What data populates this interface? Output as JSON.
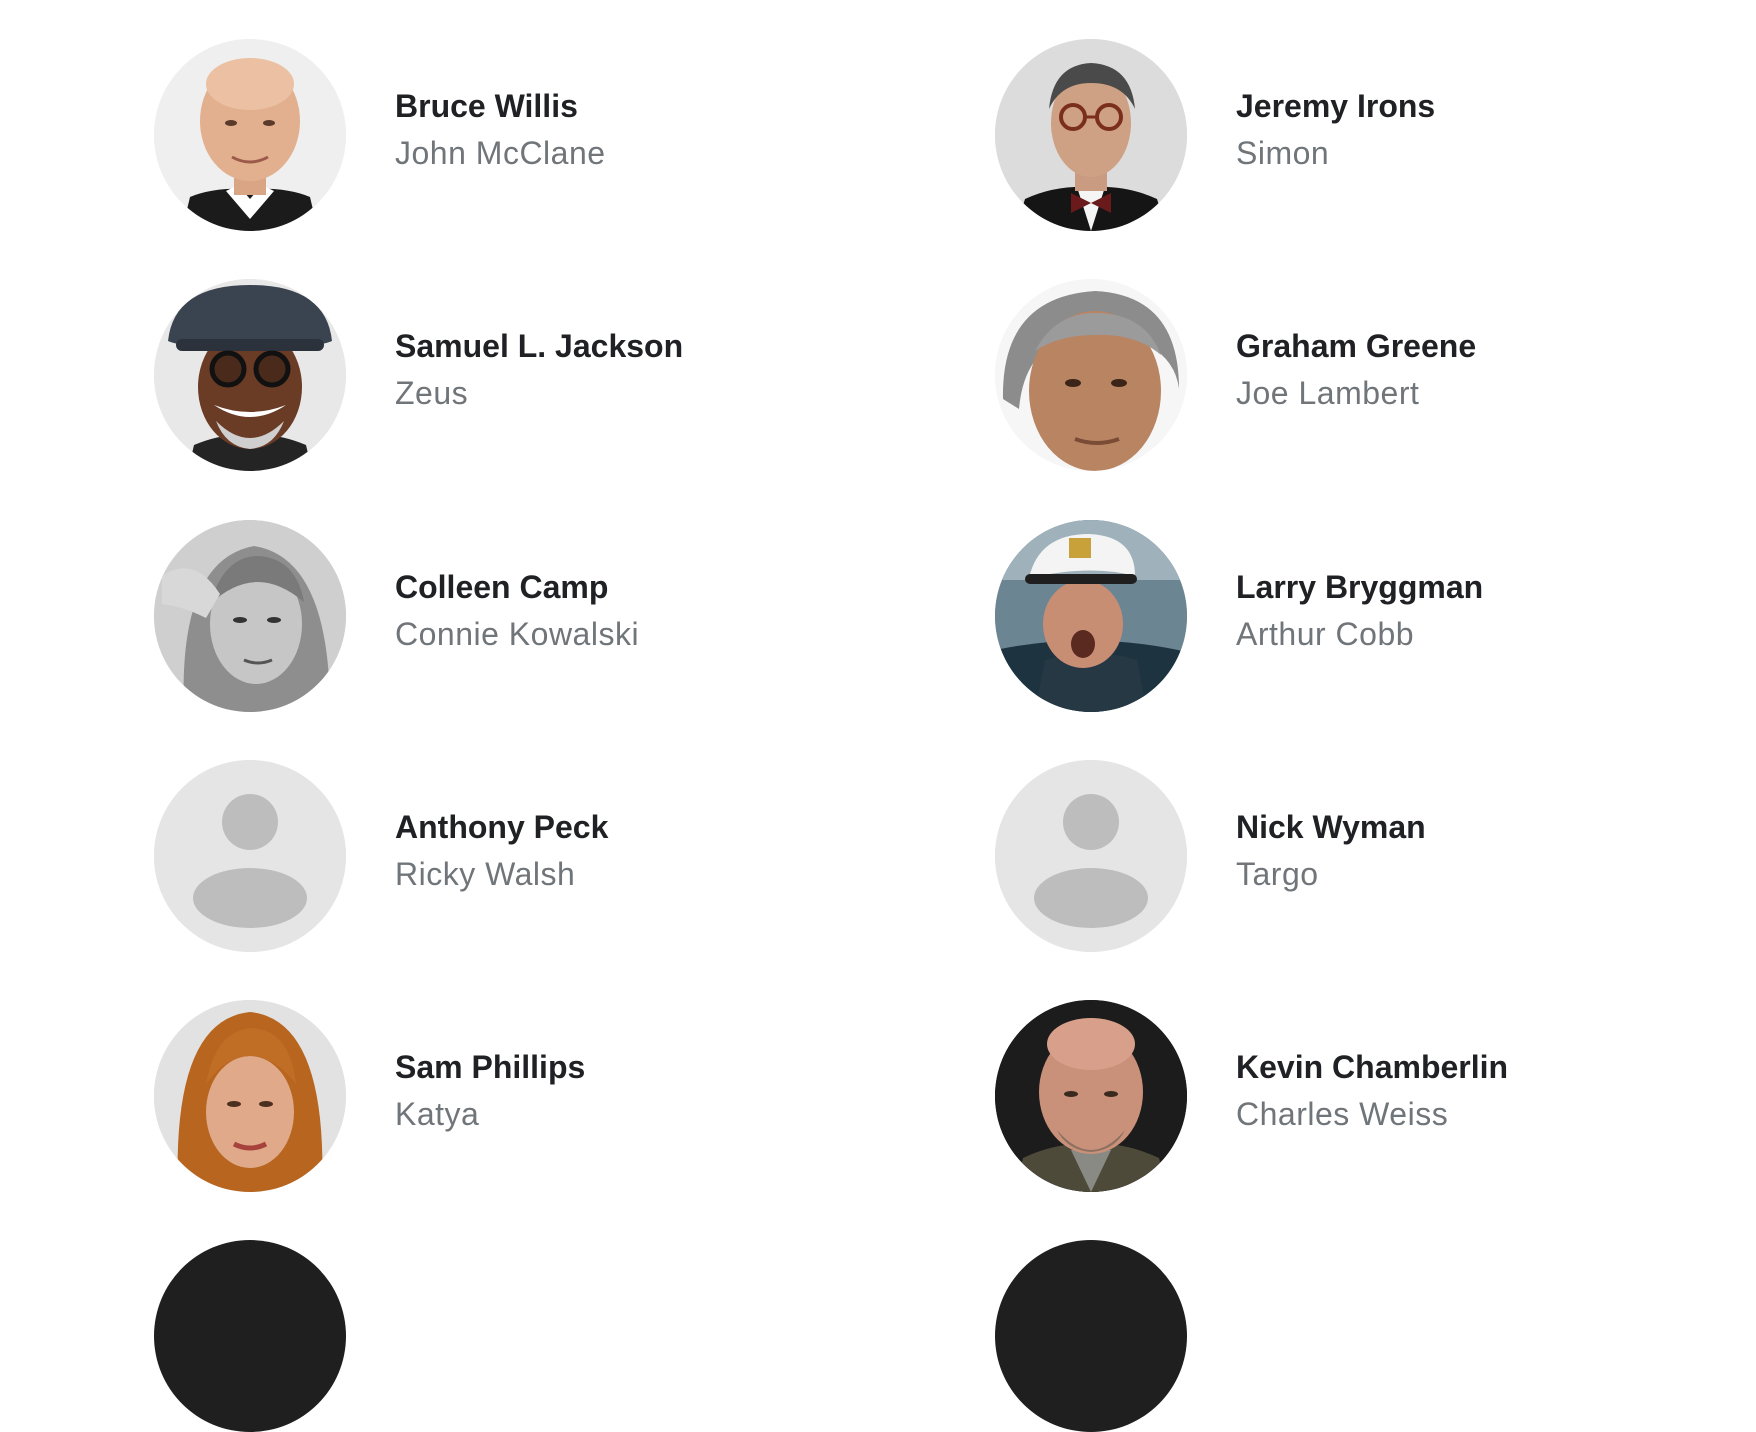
{
  "cast": [
    {
      "actor": "Bruce Willis",
      "character": "John McClane",
      "photo": "photo"
    },
    {
      "actor": "Jeremy Irons",
      "character": "Simon",
      "photo": "photo"
    },
    {
      "actor": "Samuel L. Jackson",
      "character": "Zeus",
      "photo": "photo"
    },
    {
      "actor": "Graham Greene",
      "character": "Joe Lambert",
      "photo": "photo"
    },
    {
      "actor": "Colleen Camp",
      "character": "Connie Kowalski",
      "photo": "photo"
    },
    {
      "actor": "Larry Bryggman",
      "character": "Arthur Cobb",
      "photo": "photo"
    },
    {
      "actor": "Anthony Peck",
      "character": "Ricky Walsh",
      "photo": "placeholder-person-icon"
    },
    {
      "actor": "Nick Wyman",
      "character": "Targo",
      "photo": "placeholder-person-icon"
    },
    {
      "actor": "Sam Phillips",
      "character": "Katya",
      "photo": "photo"
    },
    {
      "actor": "Kevin Chamberlin",
      "character": "Charles Weiss",
      "photo": "photo"
    }
  ],
  "colors": {
    "actor_name": "#202124",
    "character_name": "#70757a",
    "placeholder_bg": "#e5e5e5",
    "placeholder_glyph": "#bdbdbd"
  }
}
